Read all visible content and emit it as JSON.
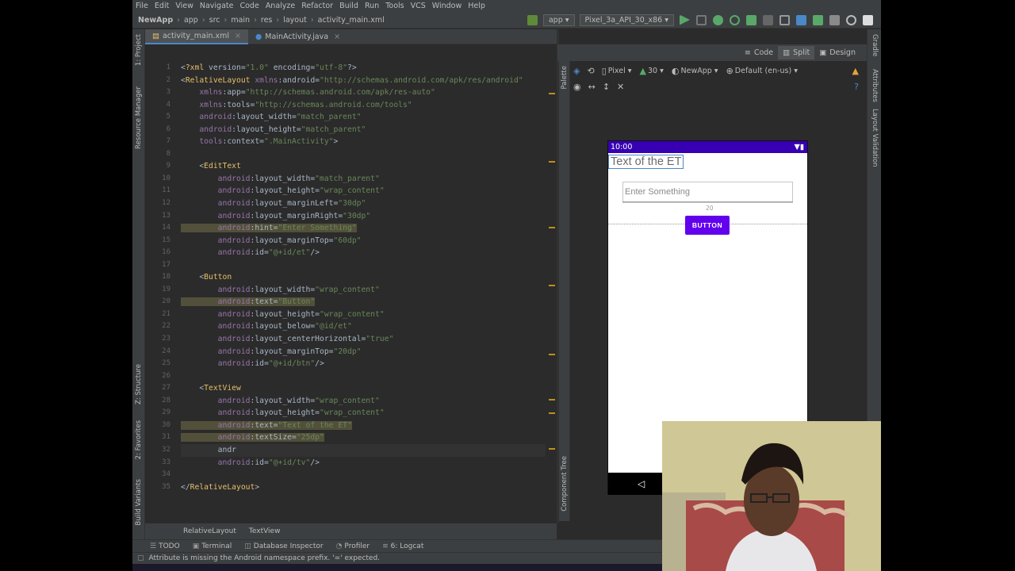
{
  "menu": [
    "File",
    "Edit",
    "View",
    "Navigate",
    "Code",
    "Analyze",
    "Refactor",
    "Build",
    "Run",
    "Tools",
    "VCS",
    "Window",
    "Help"
  ],
  "breadcrumbs": [
    "NewApp",
    "app",
    "src",
    "main",
    "res",
    "layout",
    "activity_main.xml"
  ],
  "run_config": "app",
  "device": "Pixel_3a_API_30_x86",
  "tabs": [
    {
      "label": "activity_main.xml"
    },
    {
      "label": "MainActivity.java"
    }
  ],
  "left_tools": {
    "project": "1: Project",
    "resource_manager": "Resource Manager",
    "structure": "Z: Structure",
    "favorites": "2: Favorites",
    "build_variants": "Build Variants"
  },
  "right_tools": {
    "gradle": "Gradle",
    "attributes": "Attributes",
    "layout_validation": "Layout Validation"
  },
  "view_modes": {
    "code": "Code",
    "split": "Split",
    "design": "Design"
  },
  "design_toolbar": {
    "device": "Pixel",
    "api": "30",
    "theme": "NewApp",
    "locale": "Default (en-us)"
  },
  "palette_label": "Palette",
  "component_tree_label": "Component Tree",
  "line_numbers": [
    "1",
    "2",
    "3",
    "4",
    "5",
    "6",
    "7",
    "8",
    "9",
    "10",
    "11",
    "12",
    "13",
    "14",
    "15",
    "16",
    "17",
    "18",
    "19",
    "20",
    "21",
    "22",
    "23",
    "24",
    "25",
    "26",
    "27",
    "28",
    "29",
    "30",
    "31",
    "32",
    "33",
    "34",
    "35"
  ],
  "code_lines": [
    "<?xml version=\"1.0\" encoding=\"utf-8\"?>",
    "<RelativeLayout xmlns:android=\"http://schemas.android.com/apk/res/android\"",
    "    xmlns:app=\"http://schemas.android.com/apk/res-auto\"",
    "    xmlns:tools=\"http://schemas.android.com/tools\"",
    "    android:layout_width=\"match_parent\"",
    "    android:layout_height=\"match_parent\"",
    "    tools:context=\".MainActivity\">",
    "",
    "    <EditText",
    "        android:layout_width=\"match_parent\"",
    "        android:layout_height=\"wrap_content\"",
    "        android:layout_marginLeft=\"30dp\"",
    "        android:layout_marginRight=\"30dp\"",
    "        android:hint=\"Enter Something\"",
    "        android:layout_marginTop=\"60dp\"",
    "        android:id=\"@+id/et\"/>",
    "",
    "    <Button",
    "        android:layout_width=\"wrap_content\"",
    "        android:text=\"Button\"",
    "        android:layout_height=\"wrap_content\"",
    "        android:layout_below=\"@id/et\"",
    "        android:layout_centerHorizontal=\"true\"",
    "        android:layout_marginTop=\"20dp\"",
    "        android:id=\"@+id/btn\"/>",
    "",
    "    <TextView",
    "        android:layout_width=\"wrap_content\"",
    "        android:layout_height=\"wrap_content\"",
    "        android:text=\"Text of the ET\"",
    "        android:textSize=\"25dp\"",
    "        andr",
    "        android:id=\"@+id/tv\"/>",
    "",
    "</RelativeLayout>"
  ],
  "preview": {
    "time": "10:00",
    "textview": "Text of the ET",
    "hint": "Enter Something",
    "margin_label": "20",
    "button": "BUTTON"
  },
  "editor_breadcrumbs": [
    "RelativeLayout",
    "TextView"
  ],
  "bottom_tools": [
    "TODO",
    "Terminal",
    "Database Inspector",
    "Profiler",
    "6: Logcat"
  ],
  "status_message": "Attribute is missing the Android namespace prefix. '=' expected."
}
